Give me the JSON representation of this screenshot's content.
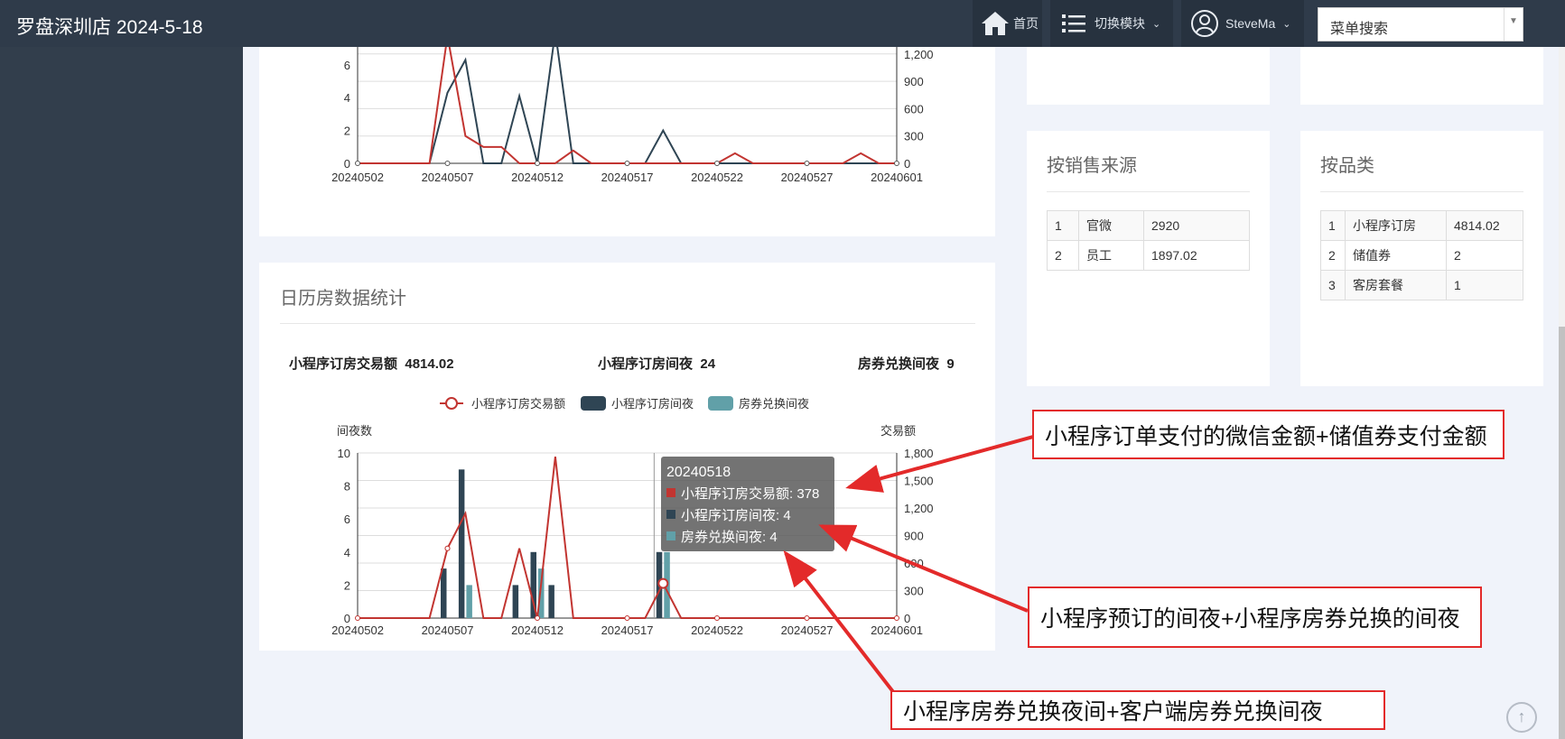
{
  "header": {
    "title": "罗盘深圳店 2024-5-18",
    "home_label": "首页",
    "module_label": "切换模块",
    "user_label": "SteveMa",
    "search_value": "菜单搜索"
  },
  "sales_source": {
    "title": "按销售来源",
    "rows": [
      {
        "idx": "1",
        "name": "官微",
        "value": "2920"
      },
      {
        "idx": "2",
        "name": "员工",
        "value": "1897.02"
      }
    ]
  },
  "category": {
    "title": "按品类",
    "rows": [
      {
        "idx": "1",
        "name": "小程序订房",
        "value": "4814.02"
      },
      {
        "idx": "2",
        "name": "储值券",
        "value": "2"
      },
      {
        "idx": "3",
        "name": "客房套餐",
        "value": "1"
      }
    ]
  },
  "calendar": {
    "title": "日历房数据统计",
    "kpis": [
      {
        "label": "小程序订房交易额",
        "value": "4814.02"
      },
      {
        "label": "小程序订房间夜",
        "value": "24"
      },
      {
        "label": "房券兑换间夜",
        "value": "9"
      }
    ]
  },
  "colors": {
    "red": "#c23531",
    "navy": "#2f4554",
    "teal": "#61a0a8",
    "callout": "#e32a2a"
  },
  "chart_data": [
    {
      "type": "line",
      "note": "top chart, partially scrolled out of view",
      "x_ticks": [
        "20240502",
        "20240507",
        "20240512",
        "20240517",
        "20240522",
        "20240527",
        "20240601"
      ],
      "y_left_ticks": [
        "0",
        "2",
        "4",
        "6"
      ],
      "y_right_ticks": [
        "0",
        "300",
        "600",
        "900",
        "1,200"
      ],
      "series": [
        {
          "values_left": [
            0,
            0,
            0,
            0,
            0,
            4.3,
            6.3,
            0,
            0,
            4.1,
            0,
            8,
            0,
            0,
            0,
            0,
            0,
            2,
            0,
            0,
            0,
            0,
            0,
            0,
            0,
            0,
            0,
            0,
            0,
            0,
            0
          ]
        },
        {
          "values_right": [
            0,
            0,
            0,
            0,
            0,
            1400,
            300,
            180,
            180,
            0,
            0,
            0,
            140,
            0,
            0,
            0,
            0,
            0,
            0,
            0,
            0,
            110,
            0,
            0,
            0,
            0,
            0,
            0,
            110,
            0,
            0
          ]
        }
      ]
    },
    {
      "type": "bar+line",
      "legend": [
        "小程序订房交易额",
        "小程序订房间夜",
        "房券兑换间夜"
      ],
      "y_left_label": "间夜数",
      "y_right_label": "交易额",
      "y_left_ticks": [
        "0",
        "2",
        "4",
        "6",
        "8",
        "10"
      ],
      "y_right_ticks": [
        "0",
        "300",
        "600",
        "900",
        "1,200",
        "1,500",
        "1,800"
      ],
      "x_ticks": [
        "20240502",
        "20240507",
        "20240512",
        "20240517",
        "20240522",
        "20240527",
        "20240601"
      ],
      "ylim_left": [
        0,
        10
      ],
      "ylim_right": [
        0,
        1800
      ],
      "series": [
        {
          "name": "小程序订房交易额",
          "kind": "line",
          "axis": "right",
          "values": [
            0,
            0,
            0,
            0,
            0,
            760,
            1140,
            0,
            0,
            760,
            0,
            1760,
            0,
            0,
            0,
            0,
            0,
            378,
            0,
            0,
            0,
            0,
            0,
            0,
            0,
            0,
            0,
            0,
            0,
            0,
            0
          ]
        },
        {
          "name": "小程序订房间夜",
          "kind": "bar",
          "axis": "left",
          "values": [
            0,
            0,
            0,
            0,
            0,
            3,
            9,
            0,
            0,
            2,
            4,
            2,
            0,
            0,
            0,
            0,
            0,
            4,
            0,
            0,
            0,
            0,
            0,
            0,
            0,
            0,
            0,
            0,
            0,
            0,
            0
          ]
        },
        {
          "name": "房券兑换间夜",
          "kind": "bar",
          "axis": "left",
          "values": [
            0,
            0,
            0,
            0,
            0,
            0,
            2,
            0,
            0,
            0,
            3,
            0,
            0,
            0,
            0,
            0,
            0,
            4,
            0,
            0,
            0,
            0,
            0,
            0,
            0,
            0,
            0,
            0,
            0,
            0,
            0
          ]
        }
      ],
      "tooltip": {
        "date": "20240518",
        "items": [
          {
            "label": "小程序订房交易额: 378"
          },
          {
            "label": "小程序订房间夜: 4"
          },
          {
            "label": "房券兑换间夜: 4"
          }
        ]
      }
    }
  ],
  "callouts": [
    {
      "text": "小程序订单支付的微信金额+储值券支付金额"
    },
    {
      "text": "小程序预订的间夜+小程序房券兑换的间夜"
    },
    {
      "text": "小程序房券兑换夜间+客户端房券兑换间夜"
    }
  ]
}
